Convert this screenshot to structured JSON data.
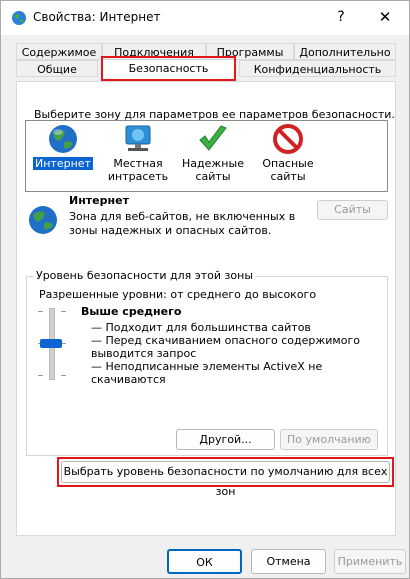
{
  "window": {
    "title": "Свойства: Интернет",
    "help_glyph": "?",
    "close_glyph": "✕"
  },
  "tabs_row1": [
    "Содержимое",
    "Подключения",
    "Программы",
    "Дополнительно"
  ],
  "tabs_row2": [
    "Общие",
    "Безопасность",
    "Конфиденциальность"
  ],
  "zone_prompt": "Выберите зону для параметров ее параметров безопасности.",
  "zones": [
    {
      "name": "Интернет",
      "icon": "globe-icon"
    },
    {
      "name": "Местная интрасеть",
      "icon": "intranet-icon"
    },
    {
      "name": "Надежные сайты",
      "icon": "checkmark-icon"
    },
    {
      "name": "Опасные сайты",
      "icon": "prohibited-icon"
    }
  ],
  "selected_zone": {
    "name": "Интернет",
    "description": "Зона для веб-сайтов, не включенных в зоны надежных и опасных сайтов.",
    "sites_button": "Сайты"
  },
  "security_level": {
    "group_title": "Уровень безопасности для этой зоны",
    "allowed": "Разрешенные уровни: от среднего до высокого",
    "level_name": "Выше среднего",
    "lines": [
      "— Подходит для большинства сайтов",
      "— Перед скачиванием опасного содержимого выводится запрос",
      "— Неподписанные элементы ActiveX не скачиваются"
    ],
    "other_button": "Другой...",
    "default_button": "По умолчанию"
  },
  "reset_all_button": "Выбрать уровень безопасности по умолчанию для всех зон",
  "footer": {
    "ok": "ОК",
    "cancel": "Отмена",
    "apply": "Применить"
  },
  "colors": {
    "highlight": "#e3161b",
    "selection": "#0a64d2",
    "ok_border": "#0067c0"
  }
}
